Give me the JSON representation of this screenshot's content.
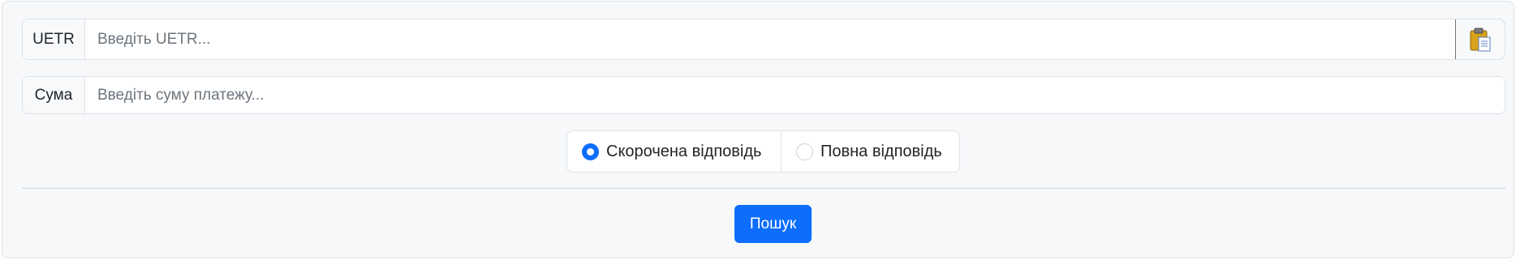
{
  "form": {
    "uetr": {
      "label": "UETR",
      "value": "",
      "placeholder": "Введіть UETR..."
    },
    "paste_button": {
      "icon": "clipboard-paste-icon"
    },
    "sum": {
      "label": "Сума",
      "value": "",
      "placeholder": "Введіть суму платежу..."
    },
    "response_mode": {
      "options": [
        {
          "label": "Скорочена відповідь",
          "checked": true
        },
        {
          "label": "Повна відповідь",
          "checked": false
        }
      ]
    },
    "search_label": "Пошук"
  },
  "colors": {
    "primary": "#0d6efd",
    "panel_background": "#f7f8fa",
    "border": "#dee2e6"
  }
}
